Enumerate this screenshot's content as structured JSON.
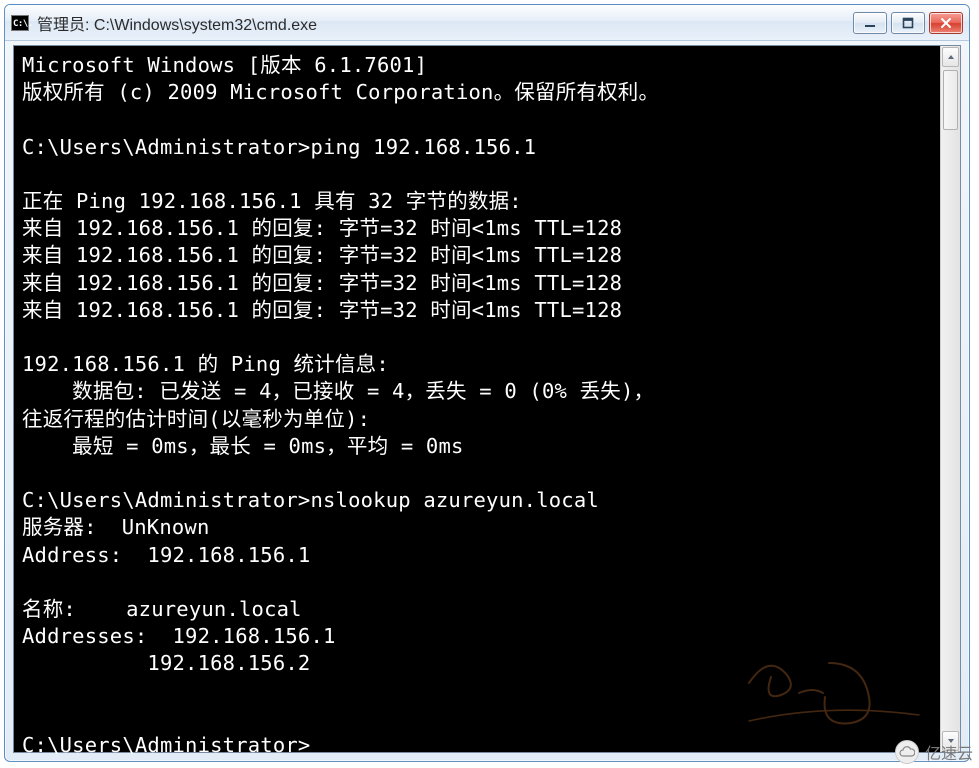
{
  "titlebar": {
    "icon_text": "C:\\.",
    "title": "管理员: C:\\Windows\\system32\\cmd.exe"
  },
  "console_lines": [
    "Microsoft Windows [版本 6.1.7601]",
    "版权所有 (c) 2009 Microsoft Corporation。保留所有权利。",
    "",
    "C:\\Users\\Administrator>ping 192.168.156.1",
    "",
    "正在 Ping 192.168.156.1 具有 32 字节的数据:",
    "来自 192.168.156.1 的回复: 字节=32 时间<1ms TTL=128",
    "来自 192.168.156.1 的回复: 字节=32 时间<1ms TTL=128",
    "来自 192.168.156.1 的回复: 字节=32 时间<1ms TTL=128",
    "来自 192.168.156.1 的回复: 字节=32 时间<1ms TTL=128",
    "",
    "192.168.156.1 的 Ping 统计信息:",
    "    数据包: 已发送 = 4，已接收 = 4，丢失 = 0 (0% 丢失)，",
    "往返行程的估计时间(以毫秒为单位):",
    "    最短 = 0ms，最长 = 0ms，平均 = 0ms",
    "",
    "C:\\Users\\Administrator>nslookup azureyun.local",
    "服务器:  UnKnown",
    "Address:  192.168.156.1",
    "",
    "名称:    azureyun.local",
    "Addresses:  192.168.156.1",
    "          192.168.156.2",
    "",
    "",
    "C:\\Users\\Administrator>"
  ],
  "watermark": {
    "text": "亿速云"
  }
}
